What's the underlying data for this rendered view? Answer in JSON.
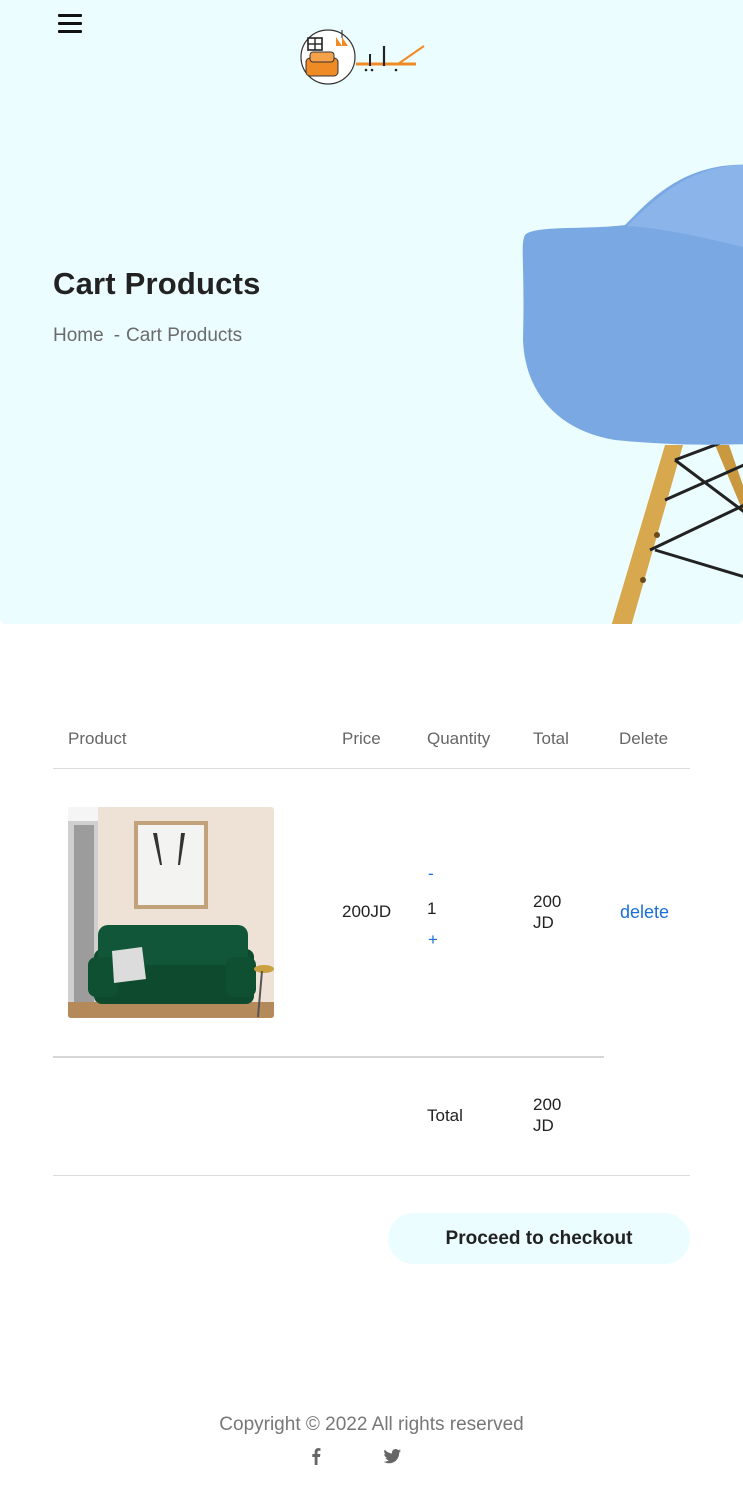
{
  "header": {
    "menu_icon": "hamburger-menu-icon",
    "logo_icon": "furniture-logo-icon"
  },
  "hero": {
    "title": "Cart Products",
    "breadcrumb": {
      "home": "Home",
      "separator": "-",
      "current": "Cart Products"
    },
    "background_color": "#ebfdff"
  },
  "cart": {
    "columns": [
      "Product",
      "Price",
      "Quantity",
      "Total",
      "Delete"
    ],
    "items": [
      {
        "image_icon": "green-sofa-product-image",
        "price": "200JD",
        "qty_minus": "-",
        "quantity": "1",
        "qty_plus": "+",
        "total": "200 JD",
        "delete_label": "delete"
      }
    ],
    "summary_label": "Total",
    "summary_value": "200 JD",
    "checkout_label": "Proceed to checkout",
    "accent_color": "#1a6fd8"
  },
  "footer": {
    "copyright": "Copyright © 2022 All rights reserved",
    "social_icons": [
      "facebook-icon",
      "twitter-icon"
    ]
  }
}
